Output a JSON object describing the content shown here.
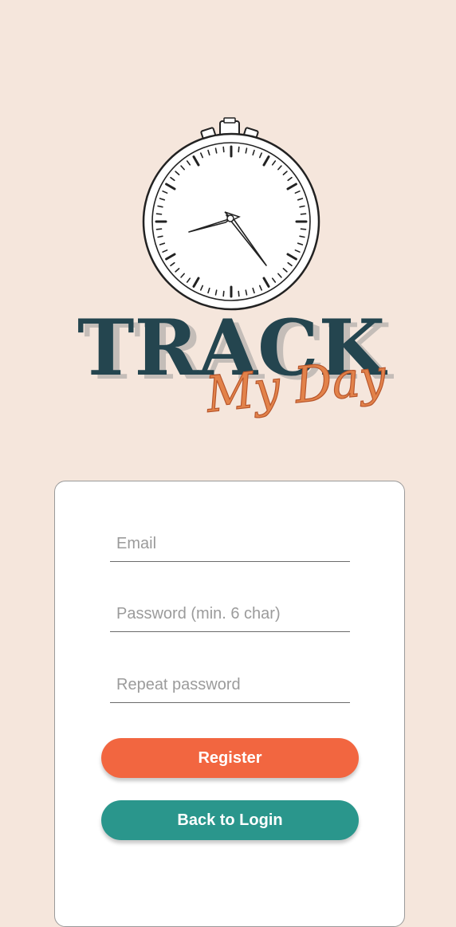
{
  "logo": {
    "title": "TRACK",
    "subtitle": "My Day",
    "icon": "stopwatch-icon"
  },
  "form": {
    "email_placeholder": "Email",
    "password_placeholder": "Password (min. 6 char)",
    "repeat_placeholder": "Repeat password",
    "register_label": "Register",
    "back_label": "Back to Login"
  },
  "colors": {
    "background": "#f5e6dc",
    "card": "#ffffff",
    "register_button": "#f26640",
    "back_button": "#2a968c",
    "title_text": "#24454f",
    "subtitle_text": "#e2824a"
  }
}
